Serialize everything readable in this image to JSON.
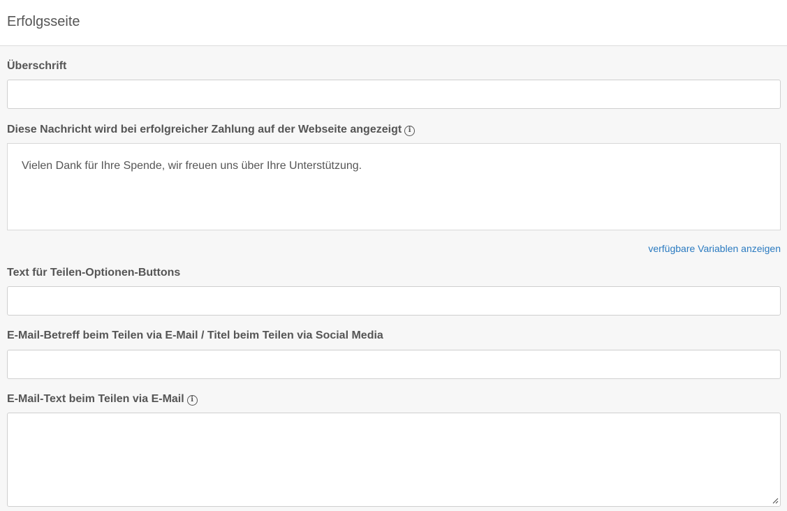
{
  "header": {
    "title": "Erfolgsseite"
  },
  "fields": {
    "heading": {
      "label": "Überschrift",
      "value": ""
    },
    "success_message": {
      "label": "Diese Nachricht wird bei erfolgreicher Zahlung auf der Webseite angezeigt",
      "value": "Vielen Dank für Ihre Spende, wir freuen uns über Ihre Unterstützung."
    },
    "variables_link": "verfügbare Variablen anzeigen",
    "share_buttons_text": {
      "label": "Text für Teilen-Optionen-Buttons",
      "value": ""
    },
    "email_subject": {
      "label": "E-Mail-Betreff beim Teilen via E-Mail / Titel beim Teilen via Social Media",
      "value": ""
    },
    "email_text": {
      "label": "E-Mail-Text beim Teilen via E-Mail",
      "value": ""
    }
  },
  "icons": {
    "info": "info-circle-icon",
    "resize": "resize-grip-icon"
  },
  "colors": {
    "link": "#2a7ac0",
    "background": "#f7f7f7",
    "text": "#555555"
  }
}
